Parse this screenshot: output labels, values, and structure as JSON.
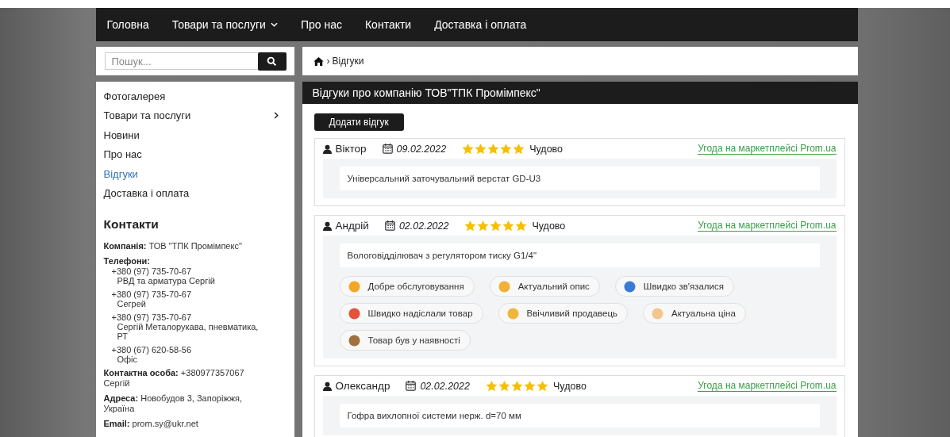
{
  "nav": [
    {
      "label": "Головна",
      "dropdown": false
    },
    {
      "label": "Товари та послуги",
      "dropdown": true
    },
    {
      "label": "Про нас",
      "dropdown": false
    },
    {
      "label": "Контакти",
      "dropdown": false
    },
    {
      "label": "Доставка і оплата",
      "dropdown": false
    }
  ],
  "search": {
    "placeholder": "Пошук..."
  },
  "breadcrumb": {
    "separator": "›",
    "current": "Відгуки"
  },
  "sidebar": {
    "items": [
      {
        "label": "Фотогалерея",
        "selected": false,
        "submenu": false
      },
      {
        "label": "Товари та послуги",
        "selected": false,
        "submenu": true
      },
      {
        "label": "Новини",
        "selected": false,
        "submenu": false
      },
      {
        "label": "Про нас",
        "selected": false,
        "submenu": false
      },
      {
        "label": "Відгуки",
        "selected": true,
        "submenu": false
      },
      {
        "label": "Доставка і оплата",
        "selected": false,
        "submenu": false
      }
    ],
    "contacts_title": "Контакти",
    "company": {
      "label": "Компанія:",
      "value": "ТОВ \"ТПК Промімпекс\""
    },
    "phones_label": "Телефони:",
    "phones": [
      {
        "number": "+380 (97) 735-70-67",
        "note": "РВД та арматура Сергій"
      },
      {
        "number": "+380 (97) 735-70-67",
        "note": "Сегрей"
      },
      {
        "number": "+380 (97) 735-70-67",
        "note": "Сергій Металорукава, пневматика, РТ"
      },
      {
        "number": "+380 (67) 620-58-56",
        "note": "Офіс"
      }
    ],
    "contact_person": {
      "label": "Контактна особа:",
      "value": "+380977357067 Сергій"
    },
    "address": {
      "label": "Адреса:",
      "value": "Новобудов 3, Запоріжжя, Україна"
    },
    "email": {
      "label": "Email:",
      "value": "prom.sy@ukr.net"
    }
  },
  "main": {
    "title": "Відгуки про компанію ТОВ\"ТПК Промімпекс\"",
    "add_button": "Додати відгук",
    "reviews": [
      {
        "author": "Віктор",
        "date": "09.02.2022",
        "stars": 5,
        "rating": "Чудово",
        "link": "Угода на маркетплейсі Prom.ua",
        "product": "Універсальний заточувальний верстат GD-U3"
      },
      {
        "author": "Андрій",
        "date": "02.02.2022",
        "stars": 5,
        "rating": "Чудово",
        "link": "Угода на маркетплейсі Prom.ua",
        "product": "Вологовідділювач з регулятором тиску G1/4\"",
        "tags": [
          "Добре обслуговування",
          "Актуальний опис",
          "Швидко зв'язалися",
          "Швидко надіслали товар",
          "Ввічливий продавець",
          "Актуальна ціна",
          "Товар був у наявності"
        ]
      },
      {
        "author": "Олександр",
        "date": "02.02.2022",
        "stars": 5,
        "rating": "Чудово",
        "link": "Угода на маркетплейсі Prom.ua",
        "product": "Гофра вихлопної системи нерж. d=70 мм"
      }
    ]
  }
}
